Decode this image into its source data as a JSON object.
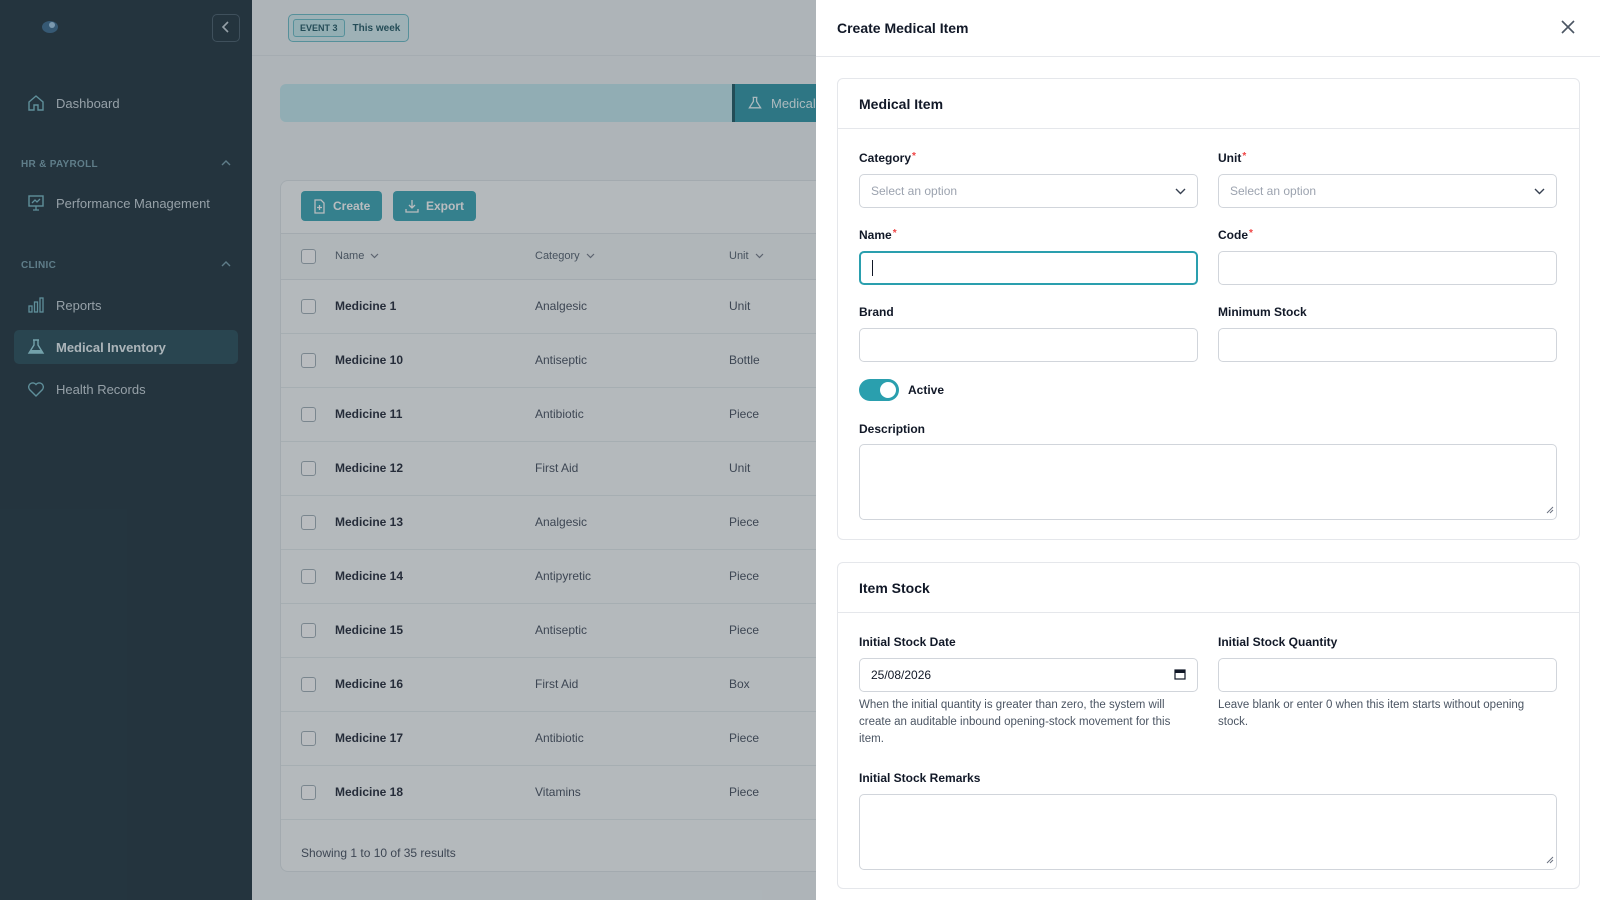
{
  "sidebar": {
    "collapse_icon": "chevron-left-icon",
    "items": [
      {
        "label": "Dashboard",
        "icon": "home-icon"
      },
      {
        "label": "Performance Management",
        "icon": "presentation-chart-icon"
      },
      {
        "label": "Reports",
        "icon": "bar-chart-icon"
      },
      {
        "label": "Medical Inventory",
        "icon": "flask-icon",
        "active": true
      },
      {
        "label": "Health Records",
        "icon": "heart-icon"
      }
    ],
    "sections": [
      {
        "label": "HR & PAYROLL"
      },
      {
        "label": "CLINIC"
      }
    ]
  },
  "topbar": {
    "event_tag": "EVENT 3",
    "event_period": "This week"
  },
  "page": {
    "tab_label": "Medical",
    "create_label": "Create",
    "export_label": "Export",
    "columns": [
      "Name",
      "Category",
      "Unit"
    ],
    "rows": [
      {
        "name": "Medicine 1",
        "category": "Analgesic",
        "unit": "Unit"
      },
      {
        "name": "Medicine 10",
        "category": "Antiseptic",
        "unit": "Bottle"
      },
      {
        "name": "Medicine 11",
        "category": "Antibiotic",
        "unit": "Piece"
      },
      {
        "name": "Medicine 12",
        "category": "First Aid",
        "unit": "Unit"
      },
      {
        "name": "Medicine 13",
        "category": "Analgesic",
        "unit": "Piece"
      },
      {
        "name": "Medicine 14",
        "category": "Antipyretic",
        "unit": "Piece"
      },
      {
        "name": "Medicine 15",
        "category": "Antiseptic",
        "unit": "Piece"
      },
      {
        "name": "Medicine 16",
        "category": "First Aid",
        "unit": "Box"
      },
      {
        "name": "Medicine 17",
        "category": "Antibiotic",
        "unit": "Piece"
      },
      {
        "name": "Medicine 18",
        "category": "Vitamins",
        "unit": "Piece"
      }
    ],
    "footer": "Showing 1 to 10 of 35 results"
  },
  "drawer": {
    "title": "Create Medical Item",
    "item_section": {
      "title": "Medical Item",
      "category_label": "Category",
      "category_placeholder": "Select an option",
      "unit_label": "Unit",
      "unit_placeholder": "Select an option",
      "name_label": "Name",
      "name_value": "",
      "code_label": "Code",
      "code_value": "",
      "brand_label": "Brand",
      "brand_value": "",
      "min_stock_label": "Minimum Stock",
      "min_stock_value": "",
      "active_label": "Active",
      "active": true,
      "description_label": "Description"
    },
    "stock_section": {
      "title": "Item Stock",
      "date_label": "Initial Stock Date",
      "date_value": "25/08/2026",
      "date_help": "When the initial quantity is greater than zero, the system will create an auditable inbound opening-stock movement for this item.",
      "qty_label": "Initial Stock Quantity",
      "qty_value": "",
      "qty_help": "Leave blank or enter 0 when this item starts without opening stock.",
      "remarks_label": "Initial Stock Remarks"
    }
  },
  "colors": {
    "sidebar_bg": "#0f2430",
    "accent": "#2a9fae",
    "required": "#ef4444"
  }
}
